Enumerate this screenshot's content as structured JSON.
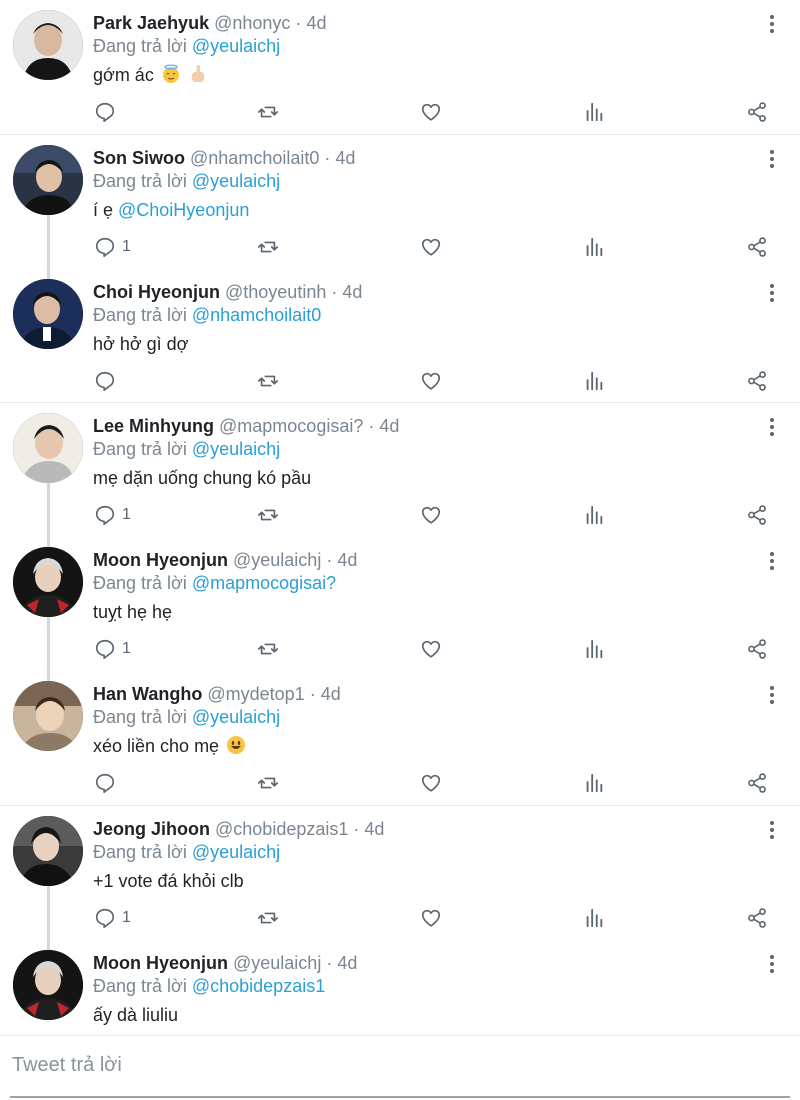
{
  "reply_prefix": "Đang trả lời",
  "tweets": [
    {
      "name": "Park Jaehyuk",
      "handle": "@nhonyc",
      "time": "4d",
      "reply_to": "@yeulaichj",
      "text": "gớm ác",
      "reply_count": "",
      "emoji": [
        "halo-face-emoji",
        "middle-finger-emoji"
      ]
    },
    {
      "name": "Son Siwoo",
      "handle": "@nhamchoilait0",
      "time": "4d",
      "reply_to": "@yeulaichj",
      "text": "í ẹ ",
      "text_mention": "@ChoiHyeonjun",
      "reply_count": "1"
    },
    {
      "name": "Choi Hyeonjun ",
      "handle": "@thoyeutinh",
      "time": "4d",
      "reply_to": "@nhamchoilait0",
      "text": "hở hở gì dợ",
      "reply_count": ""
    },
    {
      "name": "Lee Minhyung",
      "handle": "@mapmocogisai?",
      "time": "4d",
      "reply_to": "@yeulaichj",
      "text": "mẹ dặn uống chung kó pầu",
      "reply_count": "1"
    },
    {
      "name": "Moon Hyeonjun",
      "handle": "@yeulaichj",
      "time": "4d",
      "reply_to": "@mapmocogisai?",
      "text": "tuỵt hẹ hẹ",
      "reply_count": "1"
    },
    {
      "name": "Han Wangho",
      "handle": "@mydetop1",
      "time": "4d",
      "reply_to": "@yeulaichj",
      "text": "xéo liền cho mẹ",
      "reply_count": "",
      "emoji": [
        "grin-emoji"
      ]
    },
    {
      "name": "Jeong Jihoon",
      "handle": "@chobidepzais1",
      "time": "4d",
      "reply_to": "@yeulaichj",
      "text": "+1 vote đá khỏi clb",
      "reply_count": "1"
    },
    {
      "name": "Moon Hyeonjun",
      "handle": "@yeulaichj",
      "time": "4d",
      "reply_to": "@chobidepzais1",
      "text": "ấy dà liuliu",
      "reply_count": ""
    }
  ],
  "composer": {
    "placeholder": "Tweet trả lời"
  },
  "colors": {
    "mention": "#2a9fd6",
    "secondary_text": "#7b8691",
    "icon": "#5b6670",
    "divider": "#e6ecf0"
  }
}
